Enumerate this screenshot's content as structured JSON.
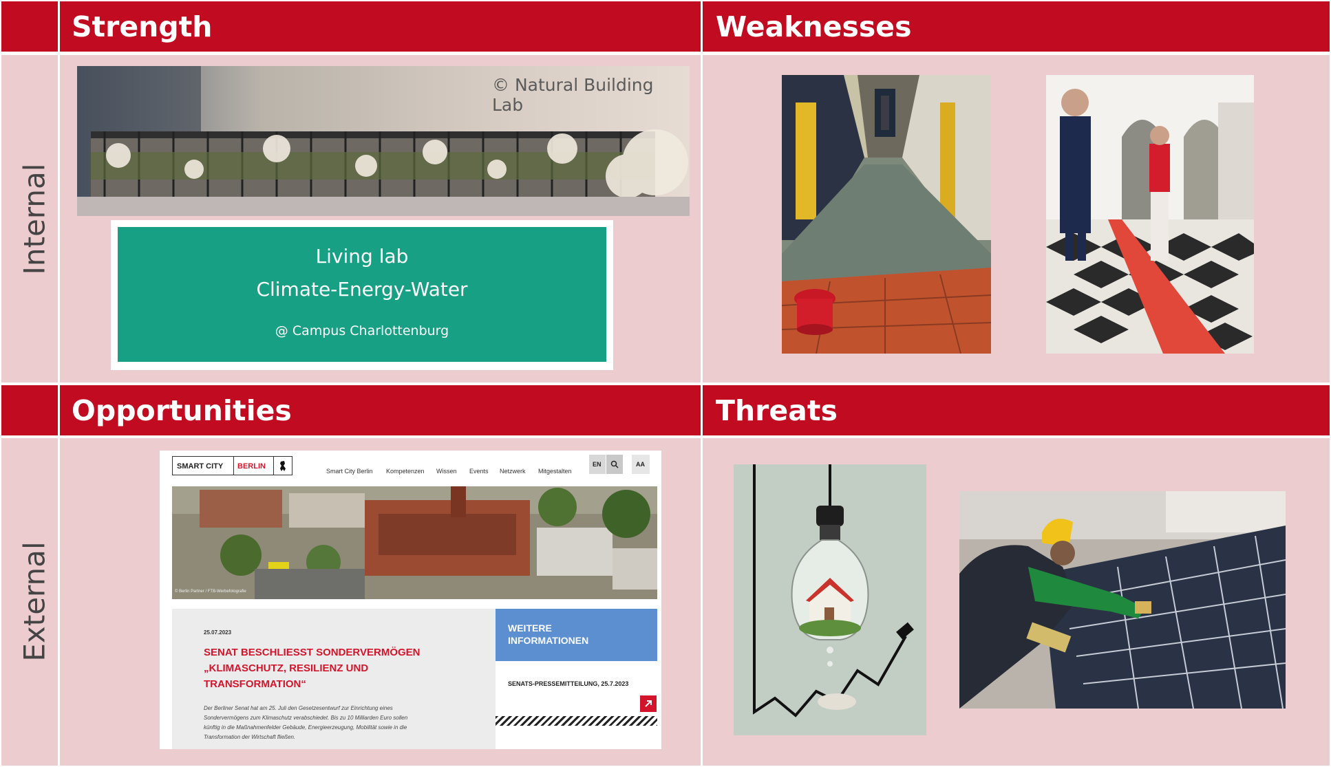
{
  "headers": {
    "strength": "Strength",
    "weaknesses": "Weaknesses",
    "opportunities": "Opportunities",
    "threats": "Threats"
  },
  "side_labels": {
    "internal": "Internal",
    "external": "External"
  },
  "strength": {
    "photo_credit": "© Natural Building Lab",
    "living_lab": {
      "line1": "Living lab",
      "line2": "Climate-Energy-Water",
      "line3": "@ Campus Charlottenburg"
    }
  },
  "website": {
    "logo_left": "SMART CITY",
    "logo_right": "BERLIN",
    "nav": [
      "Smart City Berlin",
      "Kompetenzen",
      "Wissen",
      "Events",
      "Netzwerk",
      "Mitgestalten"
    ],
    "lang": "EN",
    "font_size_btn": "AA",
    "image_credit": "© Berlin Partner / FTB-Werbefotografie",
    "date": "25.07.2023",
    "headline_1": "SENAT BESCHLIESST SONDERVERMÖGEN",
    "headline_2": "„KLIMASCHUTZ, RESILIENZ UND",
    "headline_3": "TRANSFORMATION“",
    "body_1": "Der Berliner Senat hat am 25. Juli den Gesetzesentwurf zur Einrichtung eines",
    "body_2": "Sondervermögens zum Klimaschutz verabschiedet. Bis zu 10 Milliarden Euro sollen",
    "body_3": "künftig in die Maßnahmenfelder Gebäude, Energieerzeugung, Mobilität sowie in die",
    "body_4": "Transformation der Wirtschaft fließen.",
    "info_1": "WEITERE",
    "info_2": "INFORMATIONEN",
    "press": "SENATS-PRESSEMITTEILUNG, 25.7.2023"
  },
  "colors": {
    "header_red": "#c00b20",
    "panel_pink": "#ecccce",
    "living_lab_green": "#17a084",
    "website_red": "#d2152a",
    "website_blue": "#5b8fd0"
  }
}
